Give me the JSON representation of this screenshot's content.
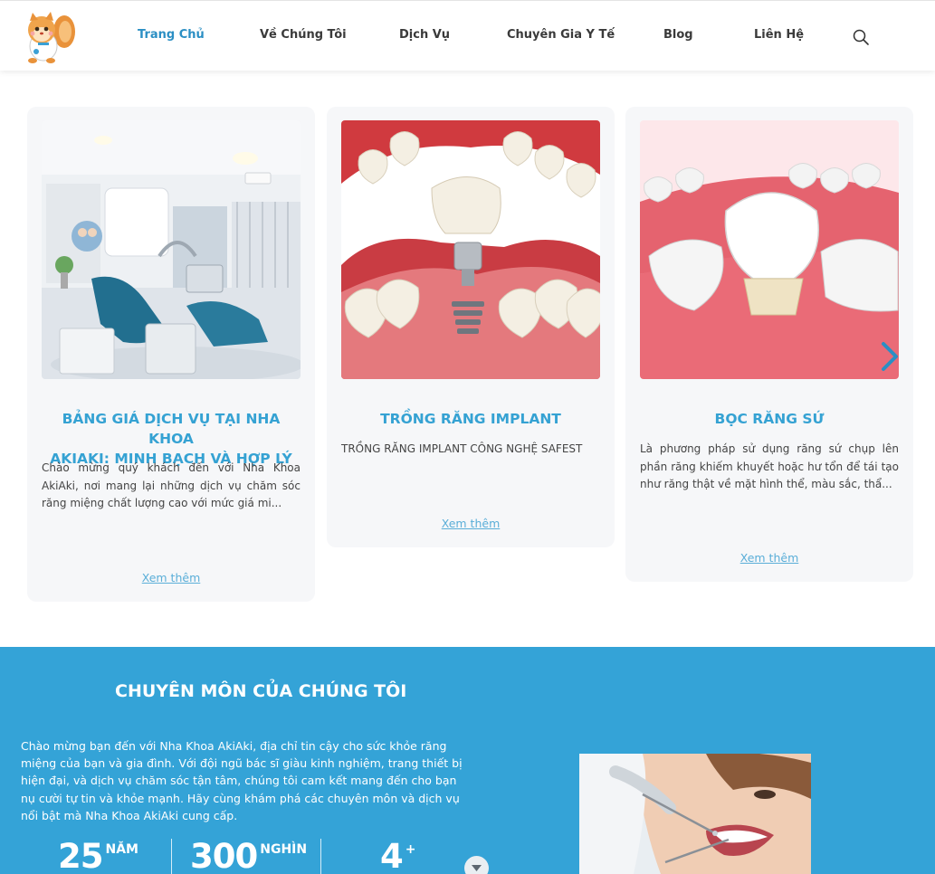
{
  "header": {
    "logo_name": "squirrel-doctor-logo",
    "nav": [
      {
        "label": "Trang Chủ",
        "active": true
      },
      {
        "label": "Về Chúng Tôi",
        "active": false
      },
      {
        "label": "Dịch Vụ",
        "active": false
      },
      {
        "label": "Chuyên Gia Y Tế",
        "active": false
      },
      {
        "label": "Blog",
        "active": false
      },
      {
        "label": "Liên Hệ",
        "active": false
      }
    ],
    "search_icon": "search-icon"
  },
  "cards": [
    {
      "title": "BẢNG GIÁ DỊCH VỤ TẠI NHA KHOA AKIAKI: MINH BẠCH VÀ HỢP LÝ",
      "title_lines": [
        "BẢNG GIÁ DỊCH VỤ TẠI NHA KHOA",
        "AKIAKI: MINH BẠCH VÀ HỢP LÝ"
      ],
      "description": "Chào mừng quý khách đến với Nha Khoa AkiAki, nơi mang lại những dịch vụ chăm sóc răng miệng chất lượng cao với mức giá mi...",
      "link": "Xem thêm",
      "image": "dental-clinic-room"
    },
    {
      "title": "TRỒNG RĂNG IMPLANT",
      "description": "TRỒNG RĂNG IMPLANT CÔNG NGHỆ SAFEST",
      "link": "Xem thêm",
      "image": "dental-implant-illustration"
    },
    {
      "title": "BỌC RĂNG SỨ",
      "description": "Là phương pháp sử dụng răng sứ chụp lên phần răng khiếm khuyết hoặc hư tổn để tái tạo như răng thật về mặt hình thể, màu sắc, thẩ...",
      "link": "Xem thêm",
      "image": "porcelain-crown-illustration"
    }
  ],
  "carousel": {
    "next_icon": "chevron-right-icon"
  },
  "expertise": {
    "title": "CHUYÊN MÔN CỦA CHÚNG TÔI",
    "text": "Chào mừng bạn đến với Nha Khoa AkiAki, địa chỉ tin cậy cho sức khỏe răng miệng của bạn và gia đình. Với đội ngũ bác sĩ giàu kinh nghiệm, trang thiết bị hiện đại, và dịch vụ chăm sóc tận tâm, chúng tôi cam kết mang đến cho bạn nụ cười tự tin và khỏe mạnh. Hãy cùng khám phá các chuyên môn và dịch vụ nổi bật mà Nha Khoa AkiAki cung cấp.",
    "stats": [
      {
        "number": "25",
        "unit": "NĂM"
      },
      {
        "number": "300",
        "unit": "NGHÌN"
      },
      {
        "number": "4",
        "unit": "+"
      }
    ],
    "scroll_icon": "chevron-down-icon",
    "photo": "patient-dental-checkup"
  },
  "colors": {
    "accent": "#2b8fc4",
    "title_blue": "#35a2d3",
    "section_bg": "#34a3d7",
    "card_bg": "#f6f7f9"
  }
}
